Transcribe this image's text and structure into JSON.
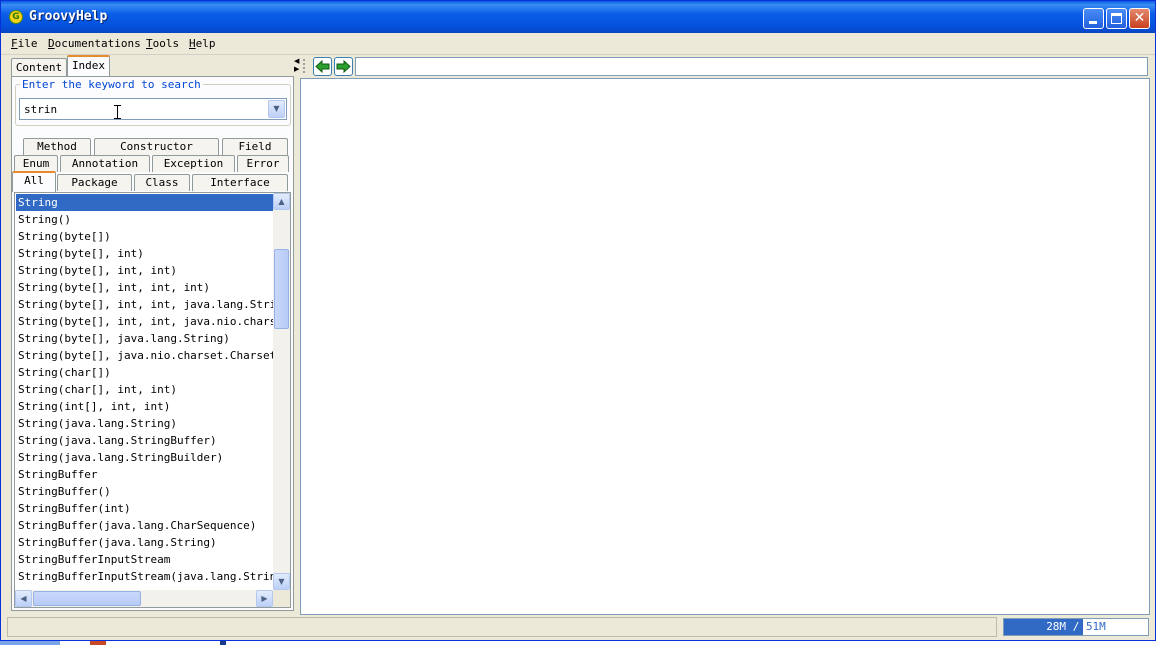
{
  "window": {
    "title": "GroovyHelp",
    "icon": "groovy-logo-icon",
    "controls": [
      "minimize-icon",
      "maximize-icon",
      "close-icon"
    ]
  },
  "menu": {
    "items": [
      "File",
      "Documentations",
      "Tools",
      "Help"
    ]
  },
  "left_tabs": [
    {
      "label": "Content",
      "selected": false
    },
    {
      "label": "Index",
      "selected": true
    }
  ],
  "search": {
    "legend": "Enter the keyword to search",
    "value": "strin"
  },
  "filter_tabs": {
    "row1": [
      "Method",
      "Constructor",
      "Field"
    ],
    "row2": [
      "Enum",
      "Annotation",
      "Exception",
      "Error"
    ],
    "row3": [
      "All",
      "Package",
      "Class",
      "Interface"
    ],
    "selected": "All"
  },
  "results": [
    "String",
    "String()",
    "String(byte[])",
    "String(byte[], int)",
    "String(byte[], int, int)",
    "String(byte[], int, int, int)",
    "String(byte[], int, int, java.lang.String)",
    "String(byte[], int, int, java.nio.charset.Charset)",
    "String(byte[], java.lang.String)",
    "String(byte[], java.nio.charset.Charset)",
    "String(char[])",
    "String(char[], int, int)",
    "String(int[], int, int)",
    "String(java.lang.String)",
    "String(java.lang.StringBuffer)",
    "String(java.lang.StringBuilder)",
    "StringBuffer",
    "StringBuffer()",
    "StringBuffer(int)",
    "StringBuffer(java.lang.CharSequence)",
    "StringBuffer(java.lang.String)",
    "StringBufferInputStream",
    "StringBufferInputStream(java.lang.String)"
  ],
  "selected_result": 0,
  "nav": {
    "back": "back-arrow-icon",
    "forward": "forward-arrow-icon",
    "url": ""
  },
  "status": {
    "used": "28M",
    "separator": "/",
    "total": "51M",
    "fraction": 0.55
  },
  "colors": {
    "title_bar": "#0551dc",
    "selection": "#316ac5",
    "tab_highlight": "#e68b2c",
    "legend_text": "#0046d5",
    "nav_arrow": "#2ca02c"
  }
}
